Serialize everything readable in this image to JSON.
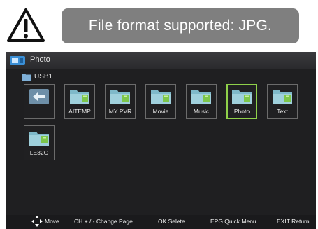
{
  "notice": {
    "icon": "warning-triangle-icon",
    "text": "File format supported: JPG."
  },
  "screen": {
    "title": "Photo",
    "title_icon": "photo-app-icon",
    "source": "USB1",
    "source_icon": "folder-icon",
    "tiles": [
      {
        "label": ". . .",
        "icon": "back-arrow-icon",
        "selected": false
      },
      {
        "label": "AITEMP",
        "icon": "folder-icon",
        "selected": false
      },
      {
        "label": "MY PVR",
        "icon": "folder-icon",
        "selected": false
      },
      {
        "label": "Movie",
        "icon": "folder-icon",
        "selected": false
      },
      {
        "label": "Music",
        "icon": "folder-icon",
        "selected": false
      },
      {
        "label": "Photo",
        "icon": "folder-icon",
        "selected": true
      },
      {
        "label": "Text",
        "icon": "folder-icon",
        "selected": false
      },
      {
        "label": "LE32G",
        "icon": "folder-icon",
        "selected": false
      }
    ],
    "selected_color": "#8fd04a",
    "footer": {
      "move": "Move",
      "change_page": "CH + / -  Change Page",
      "select": "OK  Selete",
      "quick_menu": "EPG Quick Menu",
      "return": "EXIT  Return"
    }
  }
}
